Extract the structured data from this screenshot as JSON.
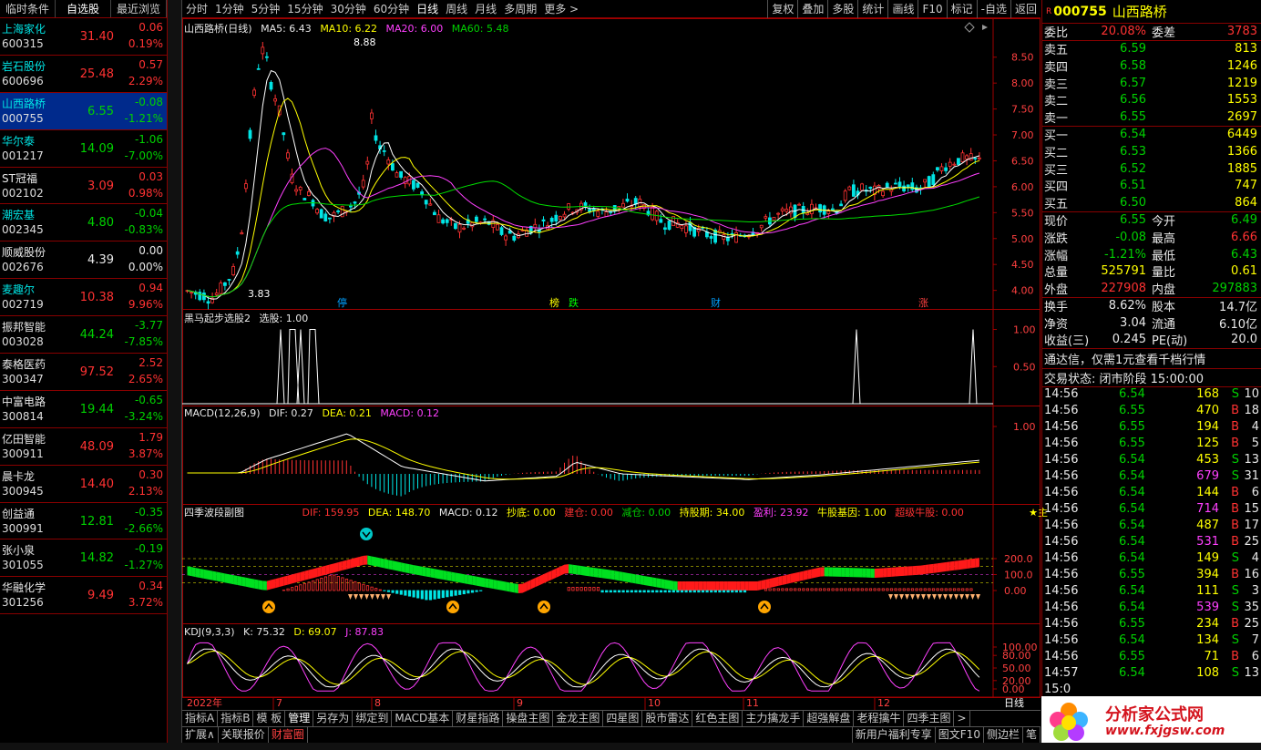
{
  "watchlist": {
    "tabs": [
      "临时条件",
      "自选股",
      "最近浏览"
    ],
    "items": [
      {
        "name": "上海家化",
        "code": "600315",
        "price": "31.40",
        "change": "0.06",
        "pct": "0.19%",
        "color": "r"
      },
      {
        "name": "岩石股份",
        "code": "600696",
        "price": "25.48",
        "change": "0.57",
        "pct": "2.29%",
        "color": "r"
      },
      {
        "name": "山西路桥",
        "code": "000755",
        "price": "6.55",
        "change": "-0.08",
        "pct": "-1.21%",
        "color": "g",
        "selected": true
      },
      {
        "name": "华尔泰",
        "code": "001217",
        "price": "14.09",
        "change": "-1.06",
        "pct": "-7.00%",
        "color": "g"
      },
      {
        "name": "ST冠福",
        "code": "002102",
        "price": "3.09",
        "change": "0.03",
        "pct": "0.98%",
        "color": "r"
      },
      {
        "name": "潮宏基",
        "code": "002345",
        "price": "4.80",
        "change": "-0.04",
        "pct": "-0.83%",
        "color": "g"
      },
      {
        "name": "顺威股份",
        "code": "002676",
        "price": "4.39",
        "change": "0.00",
        "pct": "0.00%",
        "color": "w"
      },
      {
        "name": "麦趣尔",
        "code": "002719",
        "price": "10.38",
        "change": "0.94",
        "pct": "9.96%",
        "color": "r"
      },
      {
        "name": "振邦智能",
        "code": "003028",
        "price": "44.24",
        "change": "-3.77",
        "pct": "-7.85%",
        "color": "g"
      },
      {
        "name": "泰格医药",
        "code": "300347",
        "price": "97.52",
        "change": "2.52",
        "pct": "2.65%",
        "color": "r"
      },
      {
        "name": "中富电路",
        "code": "300814",
        "price": "19.44",
        "change": "-0.65",
        "pct": "-3.24%",
        "color": "g"
      },
      {
        "name": "亿田智能",
        "code": "300911",
        "price": "48.09",
        "change": "1.79",
        "pct": "3.87%",
        "color": "r"
      },
      {
        "name": "晨卡龙",
        "code": "300945",
        "price": "14.40",
        "change": "0.30",
        "pct": "2.13%",
        "color": "r"
      },
      {
        "name": "创益通",
        "code": "300991",
        "price": "12.81",
        "change": "-0.35",
        "pct": "-2.66%",
        "color": "g"
      },
      {
        "name": "张小泉",
        "code": "301055",
        "price": "14.82",
        "change": "-0.19",
        "pct": "-1.27%",
        "color": "g"
      },
      {
        "name": "华融化学",
        "code": "301256",
        "price": "9.49",
        "change": "0.34",
        "pct": "3.72%",
        "color": "r"
      }
    ]
  },
  "topbar": {
    "left": [
      "分时",
      "1分钟",
      "5分钟",
      "15分钟",
      "30分钟",
      "60分钟",
      "日线",
      "周线",
      "月线",
      "多周期",
      "更多 >"
    ],
    "right": [
      "复权",
      "叠加",
      "多股",
      "统计",
      "画线",
      "F10",
      "标记",
      "-自选",
      "返回"
    ]
  },
  "main_chart": {
    "title": "山西路桥(日线)",
    "ma5": "MA5: 6.43",
    "ma10": "MA10: 6.22",
    "ma20": "MA20: 6.00",
    "ma60": "MA60: 5.48",
    "high_label": "8.88",
    "low_label": "3.83",
    "yticks": [
      "8.50",
      "8.00",
      "7.50",
      "7.00",
      "6.50",
      "6.00",
      "5.50",
      "5.00",
      "4.50",
      "4.00"
    ],
    "markers": [
      "停",
      "榜",
      "跌",
      "财",
      "涨"
    ]
  },
  "panel2": {
    "title": "黑马起步选股2",
    "value": "选股: 1.00",
    "yticks": [
      "1.00",
      "0.50"
    ]
  },
  "panel3": {
    "title": "MACD(12,26,9)",
    "dif": "DIF: 0.27",
    "dea": "DEA: 0.21",
    "macd": "MACD: 0.12",
    "yticks": [
      "1.00"
    ]
  },
  "panel4": {
    "title": "四季波段副图",
    "dif": "DIF: 159.95",
    "dea": "DEA: 148.70",
    "macd": "MACD: 0.12",
    "chaodi": "抄底: 0.00",
    "jiancang": "建仓: 0.00",
    "jiancang2": "减仓: 0.00",
    "chigu": "持股期: 34.00",
    "yingli": "盈利: 23.92",
    "niugu": "牛股基因: 1.00",
    "chaoji": "超级牛股: 0.00",
    "star": "★主",
    "yticks": [
      "200.0",
      "100.0",
      "0.00"
    ]
  },
  "panel5": {
    "title": "KDJ(9,3,3)",
    "k": "K: 75.32",
    "d": "D: 69.07",
    "j": "J: 87.83",
    "yticks": [
      "100.00",
      "80.00",
      "50.00",
      "20.00",
      "0.00"
    ]
  },
  "xaxis": {
    "labels": [
      "2022年",
      "7",
      "8",
      "9",
      "10",
      "11",
      "12"
    ],
    "period": "日线"
  },
  "bottom_tabs": [
    "指标A",
    "指标B",
    "模 板",
    "管理",
    "另存为",
    "绑定到",
    "MACD基本",
    "财星指路",
    "操盘主图",
    "金龙主图",
    "四星图",
    "股市雷达",
    "红色主图",
    "主力擒龙手",
    "超强解盘",
    "老程擒牛",
    "四季主图",
    ">"
  ],
  "bottom_tabs2": [
    "扩展∧",
    "关联报价",
    "财富圈"
  ],
  "bottom_right": [
    "新用户福利专享",
    "图文F10",
    "侧边栏",
    "笔"
  ],
  "quote": {
    "code": "000755",
    "name": "山西路桥",
    "weibi": "20.08%",
    "weicha": "3783",
    "sell": [
      {
        "label": "卖五",
        "price": "6.59",
        "vol": "813"
      },
      {
        "label": "卖四",
        "price": "6.58",
        "vol": "1246"
      },
      {
        "label": "卖三",
        "price": "6.57",
        "vol": "1219"
      },
      {
        "label": "卖二",
        "price": "6.56",
        "vol": "1553"
      },
      {
        "label": "卖一",
        "price": "6.55",
        "vol": "2697"
      }
    ],
    "buy": [
      {
        "label": "买一",
        "price": "6.54",
        "vol": "6449"
      },
      {
        "label": "买二",
        "price": "6.53",
        "vol": "1366"
      },
      {
        "label": "买三",
        "price": "6.52",
        "vol": "1885"
      },
      {
        "label": "买四",
        "price": "6.51",
        "vol": "747"
      },
      {
        "label": "买五",
        "price": "6.50",
        "vol": "864"
      }
    ],
    "stats": [
      {
        "l1": "现价",
        "v1": "6.55",
        "c1": "g",
        "l2": "今开",
        "v2": "6.49",
        "c2": "g"
      },
      {
        "l1": "涨跌",
        "v1": "-0.08",
        "c1": "g",
        "l2": "最高",
        "v2": "6.66",
        "c2": "r"
      },
      {
        "l1": "涨幅",
        "v1": "-1.21%",
        "c1": "g",
        "l2": "最低",
        "v2": "6.43",
        "c2": "g"
      },
      {
        "l1": "总量",
        "v1": "525791",
        "c1": "y",
        "l2": "量比",
        "v2": "0.61",
        "c2": "y"
      },
      {
        "l1": "外盘",
        "v1": "227908",
        "c1": "r",
        "l2": "内盘",
        "v2": "297883",
        "c2": "g"
      }
    ],
    "stats2": [
      {
        "l1": "换手",
        "v1": "8.62%",
        "l2": "股本",
        "v2": "14.7亿"
      },
      {
        "l1": "净资",
        "v1": "3.04",
        "l2": "流通",
        "v2": "6.10亿"
      },
      {
        "l1": "收益(三)",
        "v1": "0.245",
        "l2": "PE(动)",
        "v2": "20.0"
      }
    ],
    "ad": "通达信，仅需1元查看千档行情",
    "trade_state": "交易状态: 闭市阶段 15:00:00",
    "ticks": [
      {
        "t": "14:56",
        "p": "6.54",
        "v": "168",
        "s": "S",
        "n": "10"
      },
      {
        "t": "14:56",
        "p": "6.55",
        "v": "470",
        "s": "B",
        "n": "18"
      },
      {
        "t": "14:56",
        "p": "6.55",
        "v": "194",
        "s": "B",
        "n": "4"
      },
      {
        "t": "14:56",
        "p": "6.55",
        "v": "125",
        "s": "B",
        "n": "5"
      },
      {
        "t": "14:56",
        "p": "6.54",
        "v": "453",
        "s": "S",
        "n": "13"
      },
      {
        "t": "14:56",
        "p": "6.54",
        "v": "679",
        "s": "S",
        "n": "31"
      },
      {
        "t": "14:56",
        "p": "6.54",
        "v": "144",
        "s": "B",
        "n": "6"
      },
      {
        "t": "14:56",
        "p": "6.54",
        "v": "714",
        "s": "B",
        "n": "15"
      },
      {
        "t": "14:56",
        "p": "6.54",
        "v": "487",
        "s": "B",
        "n": "17"
      },
      {
        "t": "14:56",
        "p": "6.54",
        "v": "531",
        "s": "B",
        "n": "25"
      },
      {
        "t": "14:56",
        "p": "6.54",
        "v": "149",
        "s": "S",
        "n": "4"
      },
      {
        "t": "14:56",
        "p": "6.55",
        "v": "394",
        "s": "B",
        "n": "16"
      },
      {
        "t": "14:56",
        "p": "6.54",
        "v": "111",
        "s": "S",
        "n": "3"
      },
      {
        "t": "14:56",
        "p": "6.54",
        "v": "539",
        "s": "S",
        "n": "35"
      },
      {
        "t": "14:56",
        "p": "6.55",
        "v": "234",
        "s": "B",
        "n": "25"
      },
      {
        "t": "14:56",
        "p": "6.54",
        "v": "134",
        "s": "S",
        "n": "7"
      },
      {
        "t": "14:56",
        "p": "6.55",
        "v": "71",
        "s": "B",
        "n": "6"
      },
      {
        "t": "14:57",
        "p": "6.54",
        "v": "108",
        "s": "S",
        "n": "13"
      },
      {
        "t": "15:0",
        "p": "",
        "v": "",
        "s": "",
        "n": ""
      }
    ],
    "watermark": "分析家公式网",
    "watermark_url": "www.fxjgsw.com"
  }
}
